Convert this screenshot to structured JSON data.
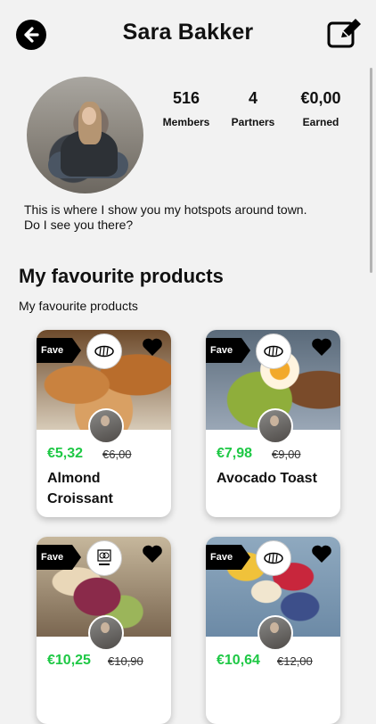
{
  "header": {
    "title": "Sara Bakker"
  },
  "profile": {
    "stats": [
      {
        "value": "516",
        "label": "Members"
      },
      {
        "value": "4",
        "label": "Partners"
      },
      {
        "value": "€0,00",
        "label": "Earned"
      }
    ],
    "bio": "This is where I show you my hotspots around town. Do I see you there?"
  },
  "section": {
    "title": "My favourite products",
    "subtitle": "My favourite products"
  },
  "products": [
    {
      "badge": "Fave",
      "price": "€5,32",
      "old_price": "€6,00",
      "name": "Almond Croissant",
      "brand_icon": "bread-icon"
    },
    {
      "badge": "Fave",
      "price": "€7,98",
      "old_price": "€9,00",
      "name": "Avocado Toast",
      "brand_icon": "bread-icon"
    },
    {
      "badge": "Fave",
      "price": "€10,25",
      "old_price": "€10,90",
      "name": "",
      "brand_icon": "bluebird-logo"
    },
    {
      "badge": "Fave",
      "price": "€10,64",
      "old_price": "€12,00",
      "name": "",
      "brand_icon": "bread-icon"
    }
  ],
  "colors": {
    "accent_price": "#1ec845",
    "background": "#f2f2f2"
  }
}
